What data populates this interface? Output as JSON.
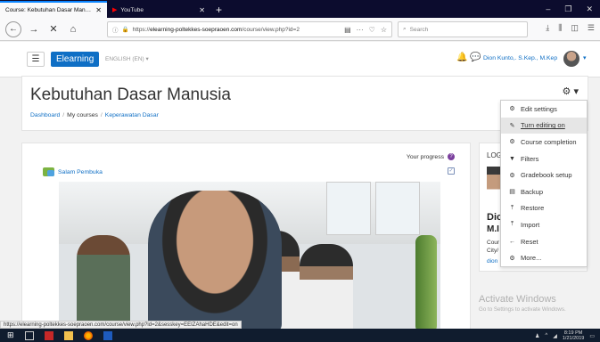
{
  "browser": {
    "tabs": [
      {
        "title": "Course: Kebutuhan Dasar Man…",
        "active": true
      },
      {
        "title": "YouTube",
        "active": false
      }
    ],
    "new_tab_label": "+",
    "url_prefix": "https://",
    "url_domain": "elearning-poltekkes-soepraoen.com",
    "url_path": "/course/view.php?id=2",
    "search_placeholder": "Search",
    "status_url": "https://elearning-poltekkes-soepraoen.com/course/view.php?id=2&sesskey=EEIZAhaHDE&edit=on"
  },
  "moodle_nav": {
    "brand": "Elearning",
    "language": "ENGLISH (EN) ▾",
    "user_name": "Dion Kunto,. S.Kep., M.Kep"
  },
  "header": {
    "title": "Kebutuhan Dasar Manusia",
    "breadcrumb": [
      "Dashboard",
      "My courses",
      "Keperawatan Dasar"
    ]
  },
  "course_menu": {
    "items": [
      {
        "label": "Edit settings",
        "icon": "gear-icon",
        "glyph": "⚙"
      },
      {
        "label": "Turn editing on",
        "icon": "pencil-icon",
        "glyph": "✎"
      },
      {
        "label": "Course completion",
        "icon": "gear-icon",
        "glyph": "⚙"
      },
      {
        "label": "Filters",
        "icon": "filter-icon",
        "glyph": "▼"
      },
      {
        "label": "Gradebook setup",
        "icon": "gear-icon",
        "glyph": "⚙"
      },
      {
        "label": "Backup",
        "icon": "backup-icon",
        "glyph": "▤"
      },
      {
        "label": "Restore",
        "icon": "restore-icon",
        "glyph": "⤒"
      },
      {
        "label": "Import",
        "icon": "import-icon",
        "glyph": "⤒"
      },
      {
        "label": "Reset",
        "icon": "reset-icon",
        "glyph": "←"
      },
      {
        "label": "More...",
        "icon": "gear-icon",
        "glyph": "⚙"
      }
    ],
    "hover_index": 1
  },
  "main": {
    "progress_label": "Your progress",
    "forum_label": "Salam Pembuka"
  },
  "side_block": {
    "title": "LOG",
    "name_line1": "Dic",
    "name_line2": "M.I",
    "line1": "Cour",
    "line2": "City/",
    "link": "dion"
  },
  "watermark": {
    "title": "Activate Windows",
    "subtitle": "Go to Settings to activate Windows."
  },
  "taskbar": {
    "time": "8:19 PM",
    "date": "1/21/2019"
  },
  "colors": {
    "accent": "#0f6fc5",
    "tabbar": "#0c0c2e",
    "notification": "#e3232d",
    "taskbar": "#101c2e"
  }
}
